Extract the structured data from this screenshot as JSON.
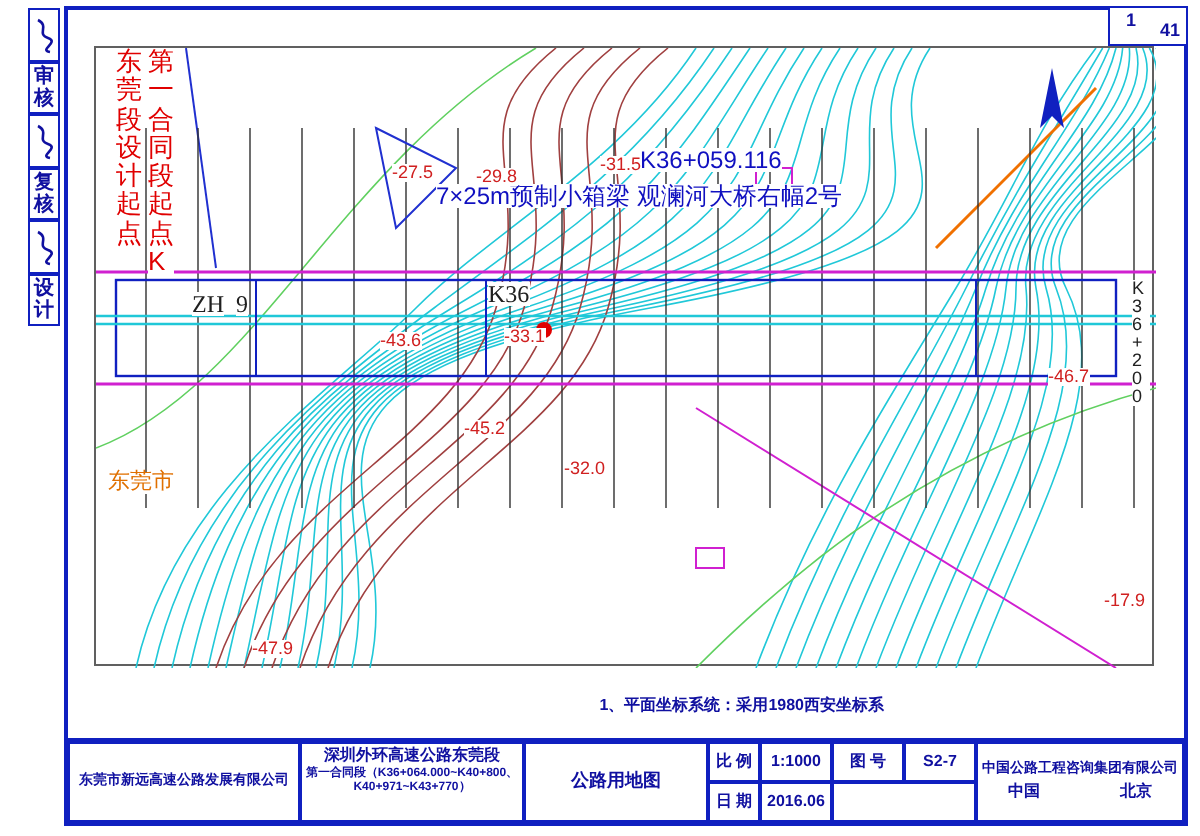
{
  "sheet": {
    "number": "1",
    "total": "41"
  },
  "signature_strip": [
    {
      "label": "审核"
    },
    {
      "label": "复核"
    },
    {
      "label": "设计"
    }
  ],
  "map": {
    "labels": [
      {
        "kind": "boundary",
        "text": "东莞段设计起点"
      },
      {
        "kind": "boundary",
        "text": "第一合同段起点K"
      },
      {
        "kind": "station",
        "text": "K36+059.116"
      },
      {
        "kind": "station",
        "text": "7×25m预制小箱梁 观澜河大桥右幅2号"
      },
      {
        "kind": "chainage",
        "text": "ZH"
      },
      {
        "kind": "chainage",
        "text": "9"
      },
      {
        "kind": "chainage",
        "text": "K36"
      },
      {
        "kind": "elevation",
        "text": "-27.5"
      },
      {
        "kind": "elevation",
        "text": "-29.8"
      },
      {
        "kind": "elevation",
        "text": "-31.5"
      },
      {
        "kind": "elevation",
        "text": "-43.6"
      },
      {
        "kind": "elevation",
        "text": "-33.1"
      },
      {
        "kind": "elevation",
        "text": "-45.2"
      },
      {
        "kind": "elevation",
        "text": "-32.0"
      },
      {
        "kind": "elevation",
        "text": "-46.7"
      },
      {
        "kind": "elevation",
        "text": "-47.9"
      },
      {
        "kind": "elevation",
        "text": "-17.9"
      },
      {
        "kind": "place",
        "text": "东莞市"
      },
      {
        "kind": "end",
        "text": "K36+200"
      }
    ]
  },
  "note": "1、平面坐标系统：采用1980西安坐标系",
  "title_block": {
    "owner": "东莞市新远高速公路发展有限公司",
    "project": "深圳外环高速公路东莞段",
    "section": "第一合同段（K36+064.000~K40+800、K40+971~K43+770）",
    "drawing": "公路用地图",
    "scale_label": "比 例",
    "scale": "1:1000",
    "number_label": "图 号",
    "date_label": "日 期",
    "date": "2016.06",
    "number": "S2-7",
    "designer": "中国公路工程咨询集团有限公司",
    "country": "中国",
    "city": "北京"
  }
}
